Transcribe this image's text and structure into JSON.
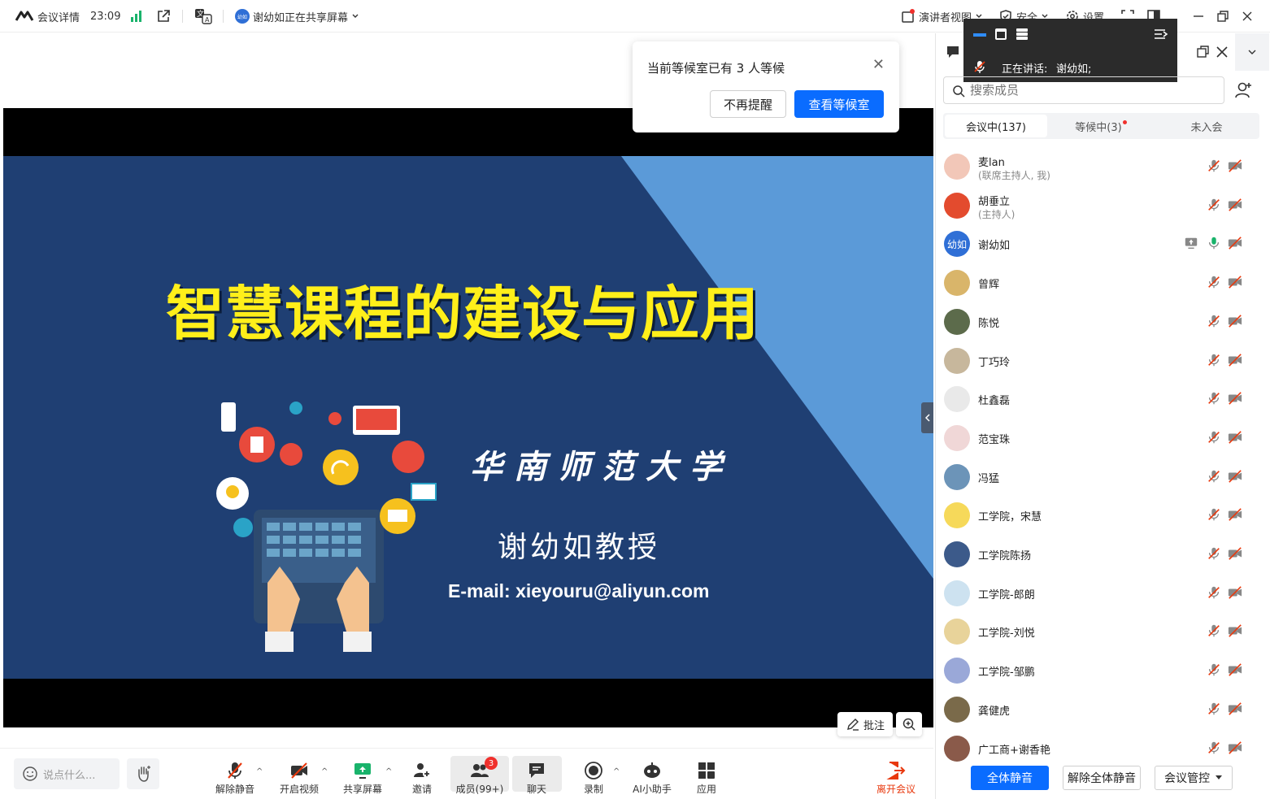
{
  "topbar": {
    "meeting_details": "会议详情",
    "time": "23:09",
    "sharing_status": "谢幼如正在共享屏幕",
    "sharer_badge": "幼如",
    "presenter_view": "演讲者视图",
    "security": "安全",
    "settings": "设置"
  },
  "popup": {
    "text": "当前等候室已有 3 人等候",
    "dismiss": "不再提醒",
    "view": "查看等候室"
  },
  "speaker": {
    "label": "正在讲话:",
    "name": "谢幼如;"
  },
  "slide": {
    "title": "智慧课程的建设与应用",
    "university": "华南师范大学",
    "professor": "谢幼如教授",
    "email": "E-mail: xieyouru@aliyun.com"
  },
  "stage": {
    "annotate": "批注"
  },
  "panel": {
    "search_placeholder": "搜索成员",
    "tabs": [
      "会议中(137)",
      "等候中(3)",
      "未入会"
    ],
    "participants": [
      {
        "name": "麦lan",
        "role": "(联席主持人, 我)",
        "color": "#f2c7b8"
      },
      {
        "name": "胡垂立",
        "role": "(主持人)",
        "color": "#e34b2e"
      },
      {
        "name": "谢幼如",
        "role": "",
        "color": "#2f6fd6",
        "initials": "幼如",
        "mic_on": true,
        "sharing": true
      },
      {
        "name": "曾辉",
        "role": "",
        "color": "#d9b56a"
      },
      {
        "name": "陈悦",
        "role": "",
        "color": "#5c6b4b"
      },
      {
        "name": "丁巧玲",
        "role": "",
        "color": "#c7b79c"
      },
      {
        "name": "杜鑫磊",
        "role": "",
        "color": "#e9e9e9"
      },
      {
        "name": "范宝珠",
        "role": "",
        "color": "#f0d7d7"
      },
      {
        "name": "冯猛",
        "role": "",
        "color": "#6c94b8"
      },
      {
        "name": "工学院，宋慧",
        "role": "",
        "color": "#f6d95a"
      },
      {
        "name": "工学院陈扬",
        "role": "",
        "color": "#3c5a8a"
      },
      {
        "name": "工学院-郎朗",
        "role": "",
        "color": "#cde2f0"
      },
      {
        "name": "工学院-刘悦",
        "role": "",
        "color": "#e8d39a"
      },
      {
        "name": "工学院-邹鹏",
        "role": "",
        "color": "#9aa8d8"
      },
      {
        "name": "龚健虎",
        "role": "",
        "color": "#7a6a4a"
      },
      {
        "name": "广工商+谢香艳",
        "role": "",
        "color": "#8a5a4a"
      }
    ],
    "mute_all": "全体静音",
    "unmute_all": "解除全体静音",
    "control": "会议管控"
  },
  "toolbar": {
    "chat_placeholder": "说点什么...",
    "unmute": "解除静音",
    "video": "开启视频",
    "share": "共享屏幕",
    "invite": "邀请",
    "members": "成员(99+)",
    "members_badge": "3",
    "chat": "聊天",
    "record": "录制",
    "ai": "AI小助手",
    "apps": "应用",
    "leave": "离开会议"
  },
  "colors": {
    "accent": "#0a6cff",
    "danger": "#e8380d",
    "slide_bg": "#1f3f73",
    "title_yellow": "#ffef1a"
  }
}
